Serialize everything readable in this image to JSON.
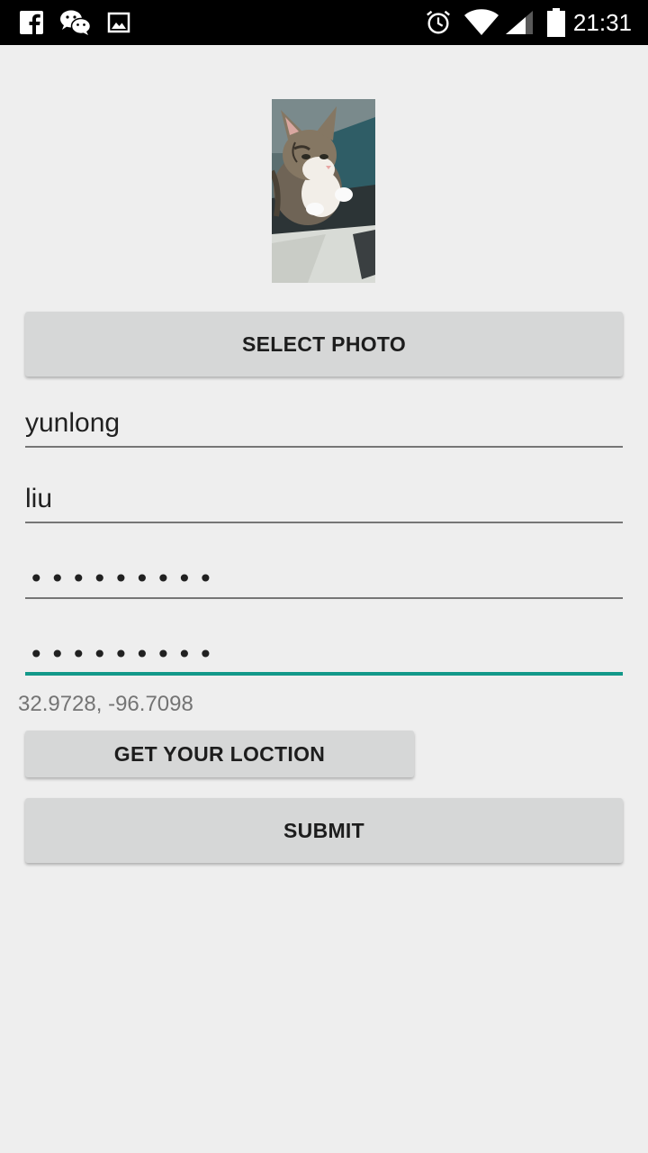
{
  "status_bar": {
    "time": "21:31",
    "left_icons": [
      "facebook-icon",
      "wechat-icon",
      "gallery-icon"
    ],
    "right_icons": [
      "alarm-icon",
      "wifi-icon",
      "signal-icon",
      "battery-icon"
    ]
  },
  "photo": {
    "description_icon": "cat-photo"
  },
  "buttons": {
    "select_photo": "SELECT PHOTO",
    "get_location": "GET YOUR LOCTION",
    "submit": "SUBMIT"
  },
  "fields": {
    "first_name": "yunlong",
    "last_name": "liu",
    "password": "•••••••••",
    "confirm_password": "•••••••••"
  },
  "location": {
    "coordinates": "32.9728, -96.7098"
  },
  "colors": {
    "accent": "#129889",
    "background": "#eeeeee",
    "button": "#d6d7d7",
    "status_bar": "#000000"
  }
}
